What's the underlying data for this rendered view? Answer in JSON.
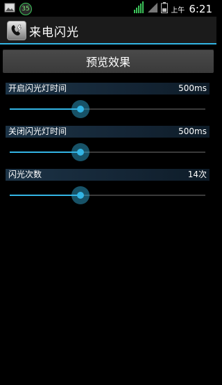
{
  "status_bar": {
    "battery_badge": "35",
    "ampm": "上午",
    "time": "6:21",
    "icons": [
      "photo-notification-icon",
      "battery-circle-icon",
      "data-signal-icon",
      "cell-signal-icon",
      "battery-icon"
    ]
  },
  "action_bar": {
    "title": "来电闪光",
    "icon": "flashlight-phone-icon"
  },
  "preview_button": {
    "label": "预览效果"
  },
  "settings": [
    {
      "label": "开启闪光灯时间",
      "value": "500ms",
      "slider_fraction": 0.36
    },
    {
      "label": "关闭闪光灯时间",
      "value": "500ms",
      "slider_fraction": 0.36
    },
    {
      "label": "闪光次数",
      "value": "14次",
      "slider_fraction": 0.36
    }
  ],
  "colors": {
    "accent": "#33b5e5",
    "background": "#000000",
    "action_bar": "#1b1b1b",
    "header_band": "#1c3346"
  }
}
